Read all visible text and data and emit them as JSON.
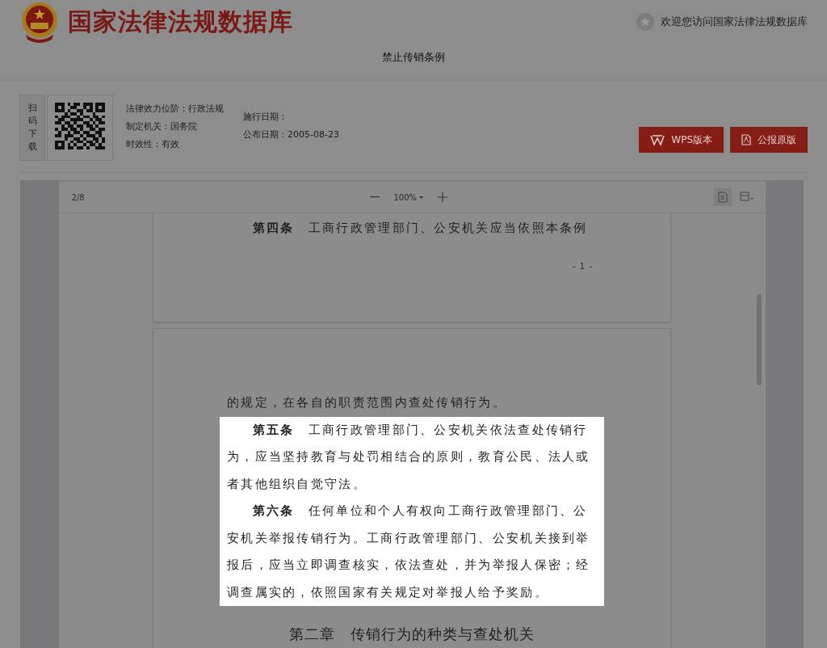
{
  "header": {
    "site_title": "国家法律法规数据库",
    "welcome": "欢迎您访问国家法律法规数据库",
    "doc_title": "禁止传销条例"
  },
  "info": {
    "qr_label": "扫码下载",
    "meta_columns": [
      [
        "法律效力位阶：行政法规",
        "制定机关：国务院",
        "时效性：有效"
      ],
      [
        "施行日期：",
        "公布日期：2005-08-23"
      ]
    ],
    "buttons": [
      {
        "kind": "wps",
        "label": "WPS版本"
      },
      {
        "kind": "pdf",
        "label": "公报原版"
      }
    ]
  },
  "viewer": {
    "page_indicator": "2/8",
    "zoom": "100%",
    "pages": [
      {
        "paragraphs": [
          {
            "kind": "article",
            "text": "**第四条**　工商行政管理部门、公安机关应当依照本条例",
            "highlighted": false
          }
        ],
        "page_number": "- 1 -"
      },
      {
        "paragraphs": [
          {
            "kind": "plain",
            "text": "的规定，在各自的职责范围内查处传销行为。",
            "highlighted": false
          },
          {
            "kind": "article",
            "text": "**第五条**　工商行政管理部门、公安机关依法查处传销行为，应当坚持教育与处罚相结合的原则，教育公民、法人或者其他组织自觉守法。",
            "highlighted": true
          },
          {
            "kind": "article",
            "text": "**第六条**　任何单位和个人有权向工商行政管理部门、公安机关举报传销行为。工商行政管理部门、公安机关接到举报后，应当立即调查核实，依法查处，并为举报人保密；经调查属实的，依照国家有关规定对举报人给予奖励。",
            "highlighted": true
          },
          {
            "kind": "chapter",
            "text": "第二章　传销行为的种类与查处机关",
            "highlighted": false
          }
        ]
      }
    ]
  }
}
